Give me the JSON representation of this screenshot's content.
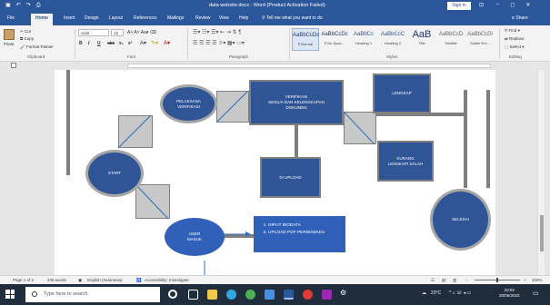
{
  "titlebar": {
    "title": "data website.docx - Word (Product Activation Failed)",
    "signin": "Sign in",
    "qat_icons": [
      "save-icon",
      "undo-icon",
      "redo-icon",
      "print-preview-icon"
    ],
    "controls": [
      "–",
      "◻",
      "✕"
    ],
    "ribbon_display": "⊡"
  },
  "tabs": {
    "items": [
      "File",
      "Home",
      "Insert",
      "Design",
      "Layout",
      "References",
      "Mailings",
      "Review",
      "View",
      "Help"
    ],
    "active": "Home",
    "tell_me": "Tell me what you want to do",
    "share": "Share"
  },
  "ribbon": {
    "clipboard": {
      "paste": "Paste",
      "cut": "Cut",
      "copy": "Copy",
      "format_painter": "Format Painter",
      "label": "Clipboard"
    },
    "font": {
      "name": "Arial",
      "size": "12",
      "label": "Font",
      "buttons": [
        "B",
        "I",
        "U",
        "abc",
        "x₂",
        "x²"
      ]
    },
    "paragraph": {
      "label": "Paragraph"
    },
    "styles": {
      "label": "Styles",
      "items": [
        {
          "preview": "AaBbCcDc",
          "name": "¶ Normal"
        },
        {
          "preview": "AaBbCcDc",
          "name": "¶ No Spac..."
        },
        {
          "preview": "AaBbCc",
          "name": "Heading 1"
        },
        {
          "preview": "AaBbCcC",
          "name": "Heading 2"
        },
        {
          "preview": "AaB",
          "name": "Title"
        },
        {
          "preview": "AaBbCcD",
          "name": "Subtitle"
        },
        {
          "preview": "AaBbCcDi",
          "name": "Subtle Em..."
        }
      ]
    },
    "editing": {
      "find": "Find",
      "replace": "Replace",
      "select": "Select",
      "label": "Editing"
    }
  },
  "diagram": {
    "pelaksana": [
      "PELAKSANA",
      "VERIFIKASI"
    ],
    "verifikasi": [
      "VERIFIKASI",
      "SESUAI DAN KELENGKAPAN",
      "DOKUMEN"
    ],
    "lengkap": "LENGKAP",
    "kurang": [
      "KURANG",
      "LENGKAP/ SALAH"
    ],
    "start": "START",
    "diupload": "DI UPLOAD",
    "selesai": "SELESAI",
    "user": [
      "USER",
      "MASUK"
    ],
    "list": [
      "INPUT BIODATA",
      "UPLOAD PDF PERWABKEU"
    ]
  },
  "statusbar": {
    "page": "Page 1 of 2",
    "words": "238 words",
    "language": "English (Indonesia)",
    "accessibility": "Accessibility: Investigate",
    "zoom": "100%"
  },
  "taskbar": {
    "search_placeholder": "Type here to search",
    "weather": "23°C",
    "time": "10:02",
    "date": "20/06/2022",
    "apps": [
      {
        "name": "cortana-icon",
        "color": "#ffffff"
      },
      {
        "name": "task-view-icon",
        "color": "#ffffff"
      },
      {
        "name": "file-explorer-icon",
        "color": "#f2c94c"
      },
      {
        "name": "edge-icon",
        "color": "#2fa8e0"
      },
      {
        "name": "chrome-icon",
        "color": "#4caf50"
      },
      {
        "name": "store-icon",
        "color": "#4a90e2"
      },
      {
        "name": "word-icon",
        "color": "#2b579a"
      },
      {
        "name": "opera-icon",
        "color": "#e53935"
      },
      {
        "name": "app-icon",
        "color": "#9c27b0"
      },
      {
        "name": "settings-icon",
        "color": "#cccccc"
      }
    ]
  },
  "colors": {
    "word_blue": "#2b579a",
    "shape_blue": "#2f5597"
  }
}
